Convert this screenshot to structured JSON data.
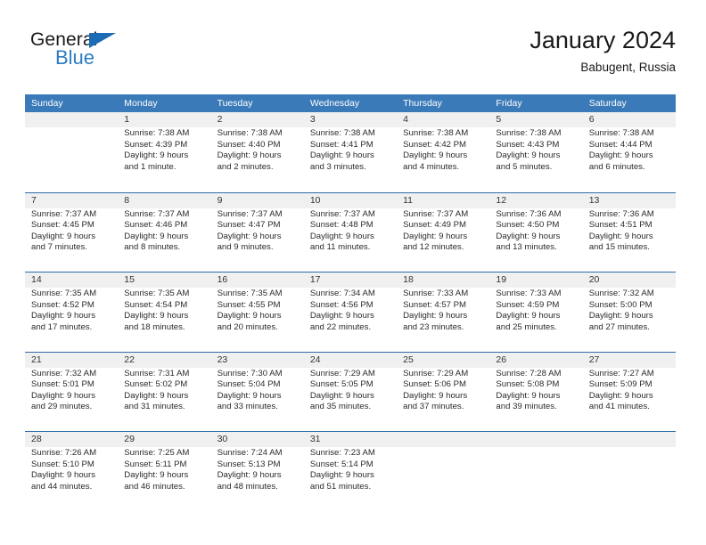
{
  "brand": {
    "name_part1": "General",
    "name_part2": "Blue",
    "triangle_color": "#1b6cb5",
    "blue_color": "#2b7cc4"
  },
  "header": {
    "title": "January 2024",
    "subtitle": "Babugent, Russia"
  },
  "theme": {
    "header_blue": "#3b7ab8",
    "row_divider_blue": "#2e6ba8",
    "daynum_band_gray": "#f0f0f0",
    "text_color": "#2b2b2b"
  },
  "weekdays": [
    "Sunday",
    "Monday",
    "Tuesday",
    "Wednesday",
    "Thursday",
    "Friday",
    "Saturday"
  ],
  "calendar": {
    "month": "January",
    "year": "2024",
    "location": "Babugent, Russia",
    "weeks": [
      [
        {
          "day": "",
          "empty": true
        },
        {
          "day": "1",
          "sunrise": "Sunrise: 7:38 AM",
          "sunset": "Sunset: 4:39 PM",
          "daylight_line1": "Daylight: 9 hours",
          "daylight_line2": "and 1 minute."
        },
        {
          "day": "2",
          "sunrise": "Sunrise: 7:38 AM",
          "sunset": "Sunset: 4:40 PM",
          "daylight_line1": "Daylight: 9 hours",
          "daylight_line2": "and 2 minutes."
        },
        {
          "day": "3",
          "sunrise": "Sunrise: 7:38 AM",
          "sunset": "Sunset: 4:41 PM",
          "daylight_line1": "Daylight: 9 hours",
          "daylight_line2": "and 3 minutes."
        },
        {
          "day": "4",
          "sunrise": "Sunrise: 7:38 AM",
          "sunset": "Sunset: 4:42 PM",
          "daylight_line1": "Daylight: 9 hours",
          "daylight_line2": "and 4 minutes."
        },
        {
          "day": "5",
          "sunrise": "Sunrise: 7:38 AM",
          "sunset": "Sunset: 4:43 PM",
          "daylight_line1": "Daylight: 9 hours",
          "daylight_line2": "and 5 minutes."
        },
        {
          "day": "6",
          "sunrise": "Sunrise: 7:38 AM",
          "sunset": "Sunset: 4:44 PM",
          "daylight_line1": "Daylight: 9 hours",
          "daylight_line2": "and 6 minutes."
        }
      ],
      [
        {
          "day": "7",
          "sunrise": "Sunrise: 7:37 AM",
          "sunset": "Sunset: 4:45 PM",
          "daylight_line1": "Daylight: 9 hours",
          "daylight_line2": "and 7 minutes."
        },
        {
          "day": "8",
          "sunrise": "Sunrise: 7:37 AM",
          "sunset": "Sunset: 4:46 PM",
          "daylight_line1": "Daylight: 9 hours",
          "daylight_line2": "and 8 minutes."
        },
        {
          "day": "9",
          "sunrise": "Sunrise: 7:37 AM",
          "sunset": "Sunset: 4:47 PM",
          "daylight_line1": "Daylight: 9 hours",
          "daylight_line2": "and 9 minutes."
        },
        {
          "day": "10",
          "sunrise": "Sunrise: 7:37 AM",
          "sunset": "Sunset: 4:48 PM",
          "daylight_line1": "Daylight: 9 hours",
          "daylight_line2": "and 11 minutes."
        },
        {
          "day": "11",
          "sunrise": "Sunrise: 7:37 AM",
          "sunset": "Sunset: 4:49 PM",
          "daylight_line1": "Daylight: 9 hours",
          "daylight_line2": "and 12 minutes."
        },
        {
          "day": "12",
          "sunrise": "Sunrise: 7:36 AM",
          "sunset": "Sunset: 4:50 PM",
          "daylight_line1": "Daylight: 9 hours",
          "daylight_line2": "and 13 minutes."
        },
        {
          "day": "13",
          "sunrise": "Sunrise: 7:36 AM",
          "sunset": "Sunset: 4:51 PM",
          "daylight_line1": "Daylight: 9 hours",
          "daylight_line2": "and 15 minutes."
        }
      ],
      [
        {
          "day": "14",
          "sunrise": "Sunrise: 7:35 AM",
          "sunset": "Sunset: 4:52 PM",
          "daylight_line1": "Daylight: 9 hours",
          "daylight_line2": "and 17 minutes."
        },
        {
          "day": "15",
          "sunrise": "Sunrise: 7:35 AM",
          "sunset": "Sunset: 4:54 PM",
          "daylight_line1": "Daylight: 9 hours",
          "daylight_line2": "and 18 minutes."
        },
        {
          "day": "16",
          "sunrise": "Sunrise: 7:35 AM",
          "sunset": "Sunset: 4:55 PM",
          "daylight_line1": "Daylight: 9 hours",
          "daylight_line2": "and 20 minutes."
        },
        {
          "day": "17",
          "sunrise": "Sunrise: 7:34 AM",
          "sunset": "Sunset: 4:56 PM",
          "daylight_line1": "Daylight: 9 hours",
          "daylight_line2": "and 22 minutes."
        },
        {
          "day": "18",
          "sunrise": "Sunrise: 7:33 AM",
          "sunset": "Sunset: 4:57 PM",
          "daylight_line1": "Daylight: 9 hours",
          "daylight_line2": "and 23 minutes."
        },
        {
          "day": "19",
          "sunrise": "Sunrise: 7:33 AM",
          "sunset": "Sunset: 4:59 PM",
          "daylight_line1": "Daylight: 9 hours",
          "daylight_line2": "and 25 minutes."
        },
        {
          "day": "20",
          "sunrise": "Sunrise: 7:32 AM",
          "sunset": "Sunset: 5:00 PM",
          "daylight_line1": "Daylight: 9 hours",
          "daylight_line2": "and 27 minutes."
        }
      ],
      [
        {
          "day": "21",
          "sunrise": "Sunrise: 7:32 AM",
          "sunset": "Sunset: 5:01 PM",
          "daylight_line1": "Daylight: 9 hours",
          "daylight_line2": "and 29 minutes."
        },
        {
          "day": "22",
          "sunrise": "Sunrise: 7:31 AM",
          "sunset": "Sunset: 5:02 PM",
          "daylight_line1": "Daylight: 9 hours",
          "daylight_line2": "and 31 minutes."
        },
        {
          "day": "23",
          "sunrise": "Sunrise: 7:30 AM",
          "sunset": "Sunset: 5:04 PM",
          "daylight_line1": "Daylight: 9 hours",
          "daylight_line2": "and 33 minutes."
        },
        {
          "day": "24",
          "sunrise": "Sunrise: 7:29 AM",
          "sunset": "Sunset: 5:05 PM",
          "daylight_line1": "Daylight: 9 hours",
          "daylight_line2": "and 35 minutes."
        },
        {
          "day": "25",
          "sunrise": "Sunrise: 7:29 AM",
          "sunset": "Sunset: 5:06 PM",
          "daylight_line1": "Daylight: 9 hours",
          "daylight_line2": "and 37 minutes."
        },
        {
          "day": "26",
          "sunrise": "Sunrise: 7:28 AM",
          "sunset": "Sunset: 5:08 PM",
          "daylight_line1": "Daylight: 9 hours",
          "daylight_line2": "and 39 minutes."
        },
        {
          "day": "27",
          "sunrise": "Sunrise: 7:27 AM",
          "sunset": "Sunset: 5:09 PM",
          "daylight_line1": "Daylight: 9 hours",
          "daylight_line2": "and 41 minutes."
        }
      ],
      [
        {
          "day": "28",
          "sunrise": "Sunrise: 7:26 AM",
          "sunset": "Sunset: 5:10 PM",
          "daylight_line1": "Daylight: 9 hours",
          "daylight_line2": "and 44 minutes."
        },
        {
          "day": "29",
          "sunrise": "Sunrise: 7:25 AM",
          "sunset": "Sunset: 5:11 PM",
          "daylight_line1": "Daylight: 9 hours",
          "daylight_line2": "and 46 minutes."
        },
        {
          "day": "30",
          "sunrise": "Sunrise: 7:24 AM",
          "sunset": "Sunset: 5:13 PM",
          "daylight_line1": "Daylight: 9 hours",
          "daylight_line2": "and 48 minutes."
        },
        {
          "day": "31",
          "sunrise": "Sunrise: 7:23 AM",
          "sunset": "Sunset: 5:14 PM",
          "daylight_line1": "Daylight: 9 hours",
          "daylight_line2": "and 51 minutes."
        },
        {
          "day": "",
          "empty": true
        },
        {
          "day": "",
          "empty": true
        },
        {
          "day": "",
          "empty": true
        }
      ]
    ]
  }
}
